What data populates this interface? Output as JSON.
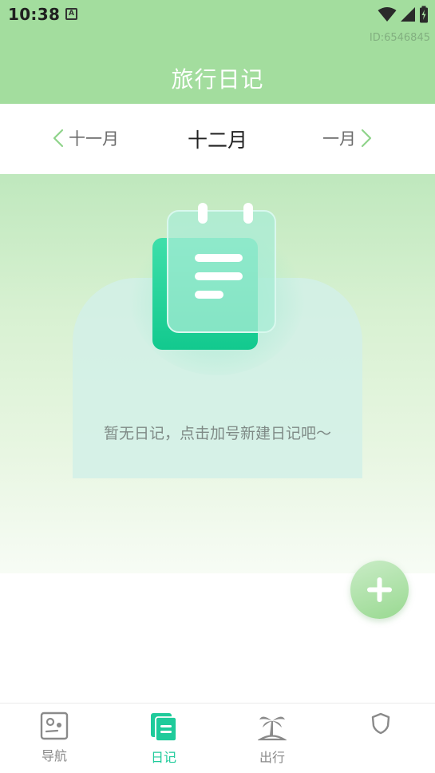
{
  "status_bar": {
    "time": "10:38",
    "notification_icon": "A"
  },
  "watermark": "ID:6546845",
  "app_title": "旅行日记",
  "month_nav": {
    "prev": "十一月",
    "current": "十二月",
    "next": "一月"
  },
  "empty_state": {
    "message": "暂无日记，点击加号新建日记吧～",
    "icon": "notebook-icon"
  },
  "fab": {
    "icon": "plus-icon"
  },
  "bottom_nav": {
    "items": [
      {
        "label": "导航",
        "icon": "map-icon",
        "active": false
      },
      {
        "label": "日记",
        "icon": "diary-icon",
        "active": true
      },
      {
        "label": "出行",
        "icon": "palm-tree-icon",
        "active": false
      },
      {
        "label": "",
        "icon": "shield-icon",
        "active": false
      }
    ]
  },
  "colors": {
    "header": "#a3dd9e",
    "accent": "#1fcb9b",
    "inactive": "#8a8a8a"
  }
}
